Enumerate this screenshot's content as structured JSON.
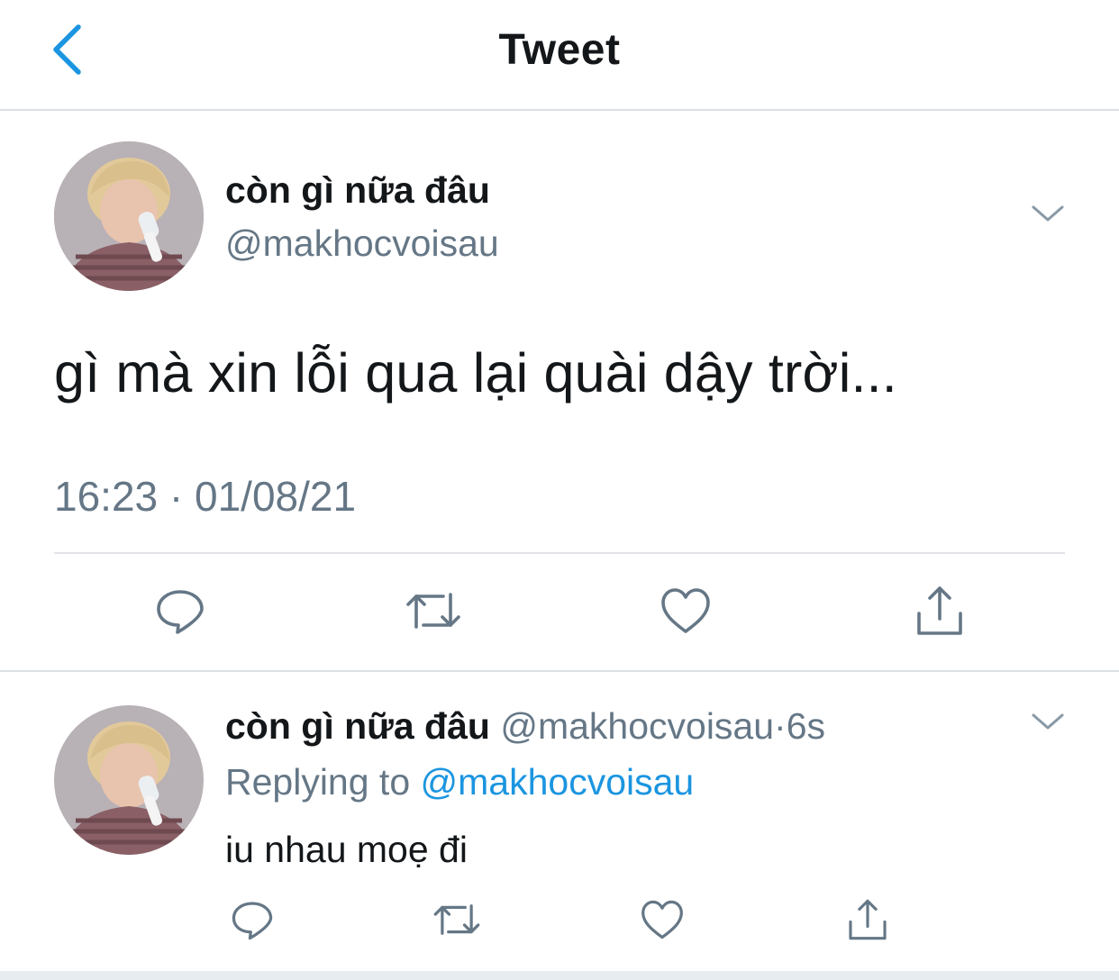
{
  "colors": {
    "accent": "#1b95e0",
    "secondary_text": "#657786",
    "primary_text": "#14171a",
    "icon_gray": "#657786",
    "divider": "#e1e4e8"
  },
  "header": {
    "back_icon": "chevron-left-icon",
    "title": "Tweet"
  },
  "tweet": {
    "display_name": "còn gì nữa đâu",
    "handle": "@makhocvoisau",
    "text": "gì mà xin lỗi qua lại quài dậy trời...",
    "timestamp": "16:23 · 01/08/21",
    "menu_icon": "chevron-down-icon",
    "actions": [
      {
        "name": "reply",
        "icon": "reply-icon"
      },
      {
        "name": "retweet",
        "icon": "retweet-icon"
      },
      {
        "name": "like",
        "icon": "heart-icon"
      },
      {
        "name": "share",
        "icon": "share-icon"
      }
    ]
  },
  "reply": {
    "display_name": "còn gì nữa đâu",
    "handle": "@makhocvoisau",
    "separator": "·",
    "time_ago": "6s",
    "replying_prefix": "Replying to",
    "replying_to": "@makhocvoisau",
    "text": "iu nhau moẹ đi",
    "menu_icon": "chevron-down-icon"
  }
}
